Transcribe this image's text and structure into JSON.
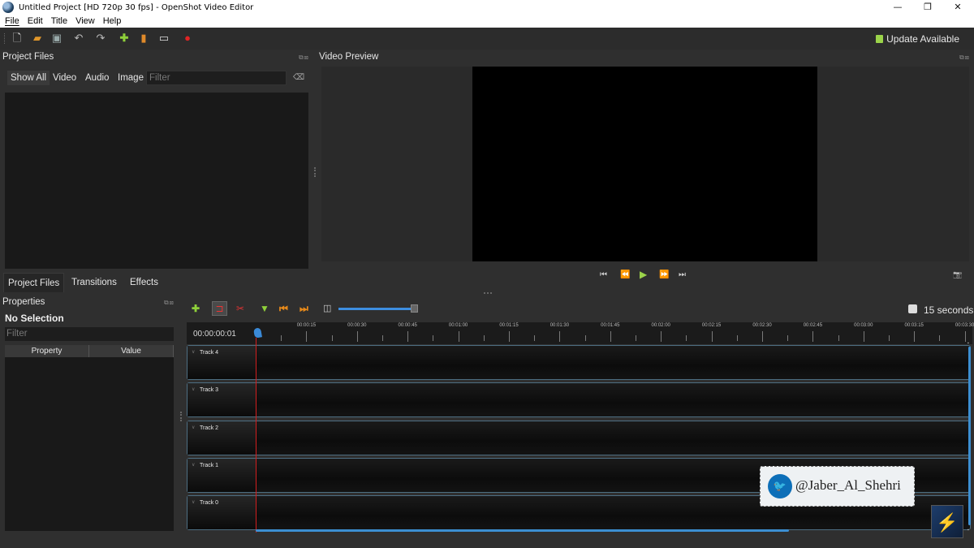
{
  "window": {
    "title": "Untitled Project [HD 720p 30 fps] - OpenShot Video Editor",
    "minimize": "—",
    "maximize": "❐",
    "close": "✕"
  },
  "menu": [
    "File",
    "Edit",
    "Title",
    "View",
    "Help"
  ],
  "toolbar": {
    "icons": [
      "new-project-icon",
      "open-project-icon",
      "save-project-icon",
      "undo-icon",
      "redo-icon",
      "import-files-icon",
      "choose-profile-icon",
      "fullscreen-icon",
      "export-video-icon"
    ],
    "update_label": "Update Available"
  },
  "project_files": {
    "title": "Project Files",
    "dock_buttons": "⧉⊠",
    "filter_tabs": [
      "Show All",
      "Video",
      "Audio",
      "Image"
    ],
    "filter_placeholder": "Filter",
    "clear_icon": "⌫"
  },
  "bottom_tabs": [
    "Project Files",
    "Transitions",
    "Effects"
  ],
  "properties": {
    "title": "Properties",
    "selection": "No Selection",
    "filter_placeholder": "Filter",
    "columns": [
      "Property",
      "Value"
    ]
  },
  "preview": {
    "title": "Video Preview",
    "controls": [
      "⏮",
      "⏪",
      "▶",
      "⏩",
      "⏭"
    ],
    "camera_icon": "📷"
  },
  "timeline": {
    "timecode": "00:00:00:01",
    "zoom_fraction": 0.97,
    "zoom_label": "15 seconds",
    "ruler_labels": [
      "00:00:15",
      "00:00:30",
      "00:00:45",
      "00:01:00",
      "00:01:15",
      "00:01:30",
      "00:01:45",
      "00:02:00",
      "00:02:15",
      "00:02:30",
      "00:02:45",
      "00:03:00",
      "00:03:15",
      "00:03:30"
    ],
    "tracks": [
      "Track 4",
      "Track 3",
      "Track 2",
      "Track 1",
      "Track 0"
    ]
  },
  "watermark": {
    "handle": "@Jaber_Al_Shehri",
    "twitter_icon": "twitter-bird-icon",
    "logo_icon": "lightning-logo-icon"
  },
  "colors": {
    "accent": "#3d8ee0",
    "playhead": "#d21e1e",
    "update_icon": "#9bd34a",
    "twitter_blue": "#0d6fb8"
  }
}
